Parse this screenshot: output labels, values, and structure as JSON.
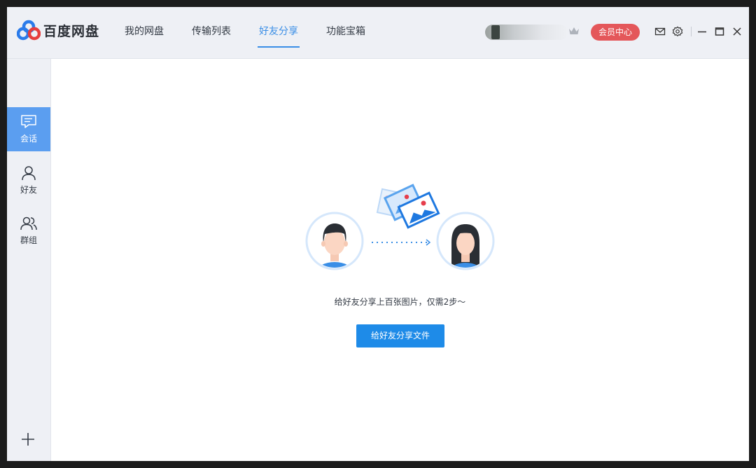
{
  "app": {
    "name": "百度网盘"
  },
  "nav": {
    "tabs": [
      "我的网盘",
      "传输列表",
      "好友分享",
      "功能宝箱"
    ],
    "active_index": 2
  },
  "header": {
    "vip_label": "会员中心"
  },
  "sidebar": {
    "items": [
      {
        "label": "会话",
        "icon": "chat-icon",
        "active": true
      },
      {
        "label": "好友",
        "icon": "person-icon",
        "active": false
      },
      {
        "label": "群组",
        "icon": "group-icon",
        "active": false
      }
    ],
    "add_icon": "plus-icon"
  },
  "main": {
    "hint": "给好友分享上百张图片，仅需2步～",
    "share_button": "给好友分享文件"
  },
  "colors": {
    "accent": "#3a8ee6",
    "vip": "#e4575a",
    "button": "#1e8be8",
    "sidebar_active": "#5b9ef0"
  }
}
